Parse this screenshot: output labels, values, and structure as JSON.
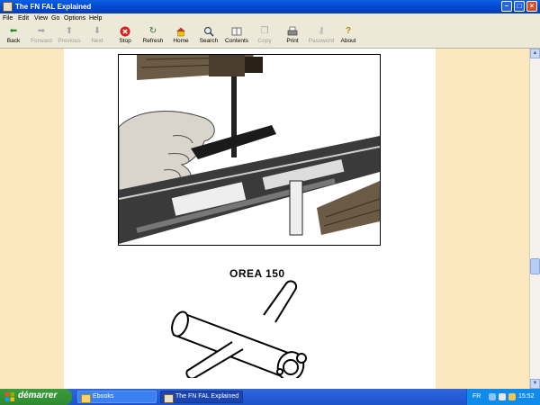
{
  "window": {
    "title": "The FN FAL Explained"
  },
  "menu": [
    "File",
    "Edit",
    "View",
    "Go",
    "Options",
    "Help"
  ],
  "toolbar": [
    {
      "label": "Back",
      "icon": "back-arrow-icon",
      "enabled": true
    },
    {
      "label": "Forward",
      "icon": "forward-arrow-icon",
      "enabled": false
    },
    {
      "label": "Previous",
      "icon": "up-arrow-icon",
      "enabled": false
    },
    {
      "label": "Next",
      "icon": "down-arrow-icon",
      "enabled": false
    },
    {
      "label": "Stop",
      "icon": "stop-icon",
      "enabled": true
    },
    {
      "label": "Refresh",
      "icon": "refresh-icon",
      "enabled": true
    },
    {
      "label": "Home",
      "icon": "home-icon",
      "enabled": true
    },
    {
      "label": "Search",
      "icon": "search-icon",
      "enabled": true
    },
    {
      "label": "Contents",
      "icon": "contents-icon",
      "enabled": true
    },
    {
      "label": "Copy",
      "icon": "copy-icon",
      "enabled": false
    },
    {
      "label": "Print",
      "icon": "print-icon",
      "enabled": true
    },
    {
      "label": "Password",
      "icon": "key-icon",
      "enabled": false
    },
    {
      "label": "About",
      "icon": "about-icon",
      "enabled": true
    }
  ],
  "content": {
    "caption": "OREA 150",
    "photo_icon": "tool-in-rifle-photo",
    "drawing_icon": "t-handle-wrench-drawing"
  },
  "taskbar": {
    "start_label": "démarrer",
    "tasks": [
      {
        "label": "Ebooks",
        "icon": "folder-icon",
        "active": false
      },
      {
        "label": "The FN FAL Explained",
        "icon": "ebook-icon",
        "active": true
      }
    ],
    "tray": {
      "language": "FR",
      "clock": "15:52"
    }
  },
  "colors": {
    "titlebar": "#0A5FE5",
    "page_margin": "#FBE8BE",
    "taskbar": "#245EDB",
    "start_button": "#3C9A3C"
  }
}
